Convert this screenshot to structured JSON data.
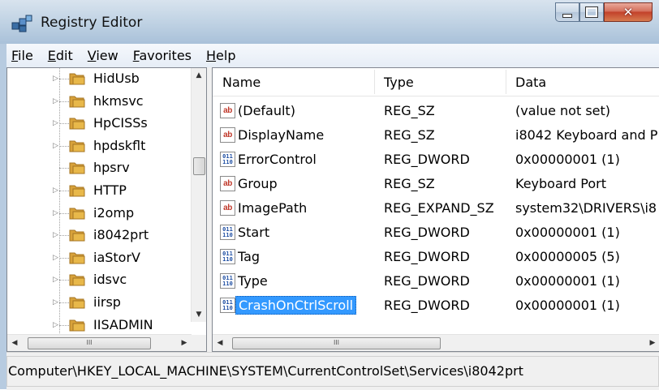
{
  "window": {
    "title": "Registry Editor"
  },
  "menu": [
    {
      "label": "File"
    },
    {
      "label": "Edit"
    },
    {
      "label": "View"
    },
    {
      "label": "Favorites"
    },
    {
      "label": "Help"
    }
  ],
  "tree": {
    "items": [
      {
        "label": "HidUsb",
        "expandable": true
      },
      {
        "label": "hkmsvc",
        "expandable": true
      },
      {
        "label": "HpCISSs",
        "expandable": true
      },
      {
        "label": "hpdskflt",
        "expandable": true
      },
      {
        "label": "hpsrv",
        "expandable": false
      },
      {
        "label": "HTTP",
        "expandable": true
      },
      {
        "label": "i2omp",
        "expandable": true
      },
      {
        "label": "i8042prt",
        "expandable": true
      },
      {
        "label": "iaStorV",
        "expandable": true
      },
      {
        "label": "idsvc",
        "expandable": true
      },
      {
        "label": "iirsp",
        "expandable": true
      },
      {
        "label": "IISADMIN",
        "expandable": true
      }
    ]
  },
  "list": {
    "columns": {
      "name": "Name",
      "type": "Type",
      "data": "Data"
    },
    "rows": [
      {
        "icon": "string-value-icon",
        "name": "(Default)",
        "type": "REG_SZ",
        "data": "(value not set)"
      },
      {
        "icon": "string-value-icon",
        "name": "DisplayName",
        "type": "REG_SZ",
        "data": "i8042 Keyboard and P"
      },
      {
        "icon": "dword-value-icon",
        "name": "ErrorControl",
        "type": "REG_DWORD",
        "data": "0x00000001 (1)"
      },
      {
        "icon": "string-value-icon",
        "name": "Group",
        "type": "REG_SZ",
        "data": "Keyboard Port"
      },
      {
        "icon": "string-value-icon",
        "name": "ImagePath",
        "type": "REG_EXPAND_SZ",
        "data": "system32\\DRIVERS\\i8"
      },
      {
        "icon": "dword-value-icon",
        "name": "Start",
        "type": "REG_DWORD",
        "data": "0x00000001 (1)"
      },
      {
        "icon": "dword-value-icon",
        "name": "Tag",
        "type": "REG_DWORD",
        "data": "0x00000005 (5)"
      },
      {
        "icon": "dword-value-icon",
        "name": "Type",
        "type": "REG_DWORD",
        "data": "0x00000001 (1)"
      },
      {
        "icon": "dword-value-icon",
        "name": "CrashOnCtrlScroll",
        "type": "REG_DWORD",
        "data": "0x00000001 (1)",
        "selected": true
      }
    ]
  },
  "status": {
    "path": "Computer\\HKEY_LOCAL_MACHINE\\SYSTEM\\CurrentControlSet\\Services\\i8042prt"
  },
  "colors": {
    "selection": "#3399ff",
    "folder": "#e8b84a",
    "string_icon": "#c0392b",
    "dword_icon": "#1f4fa3"
  }
}
